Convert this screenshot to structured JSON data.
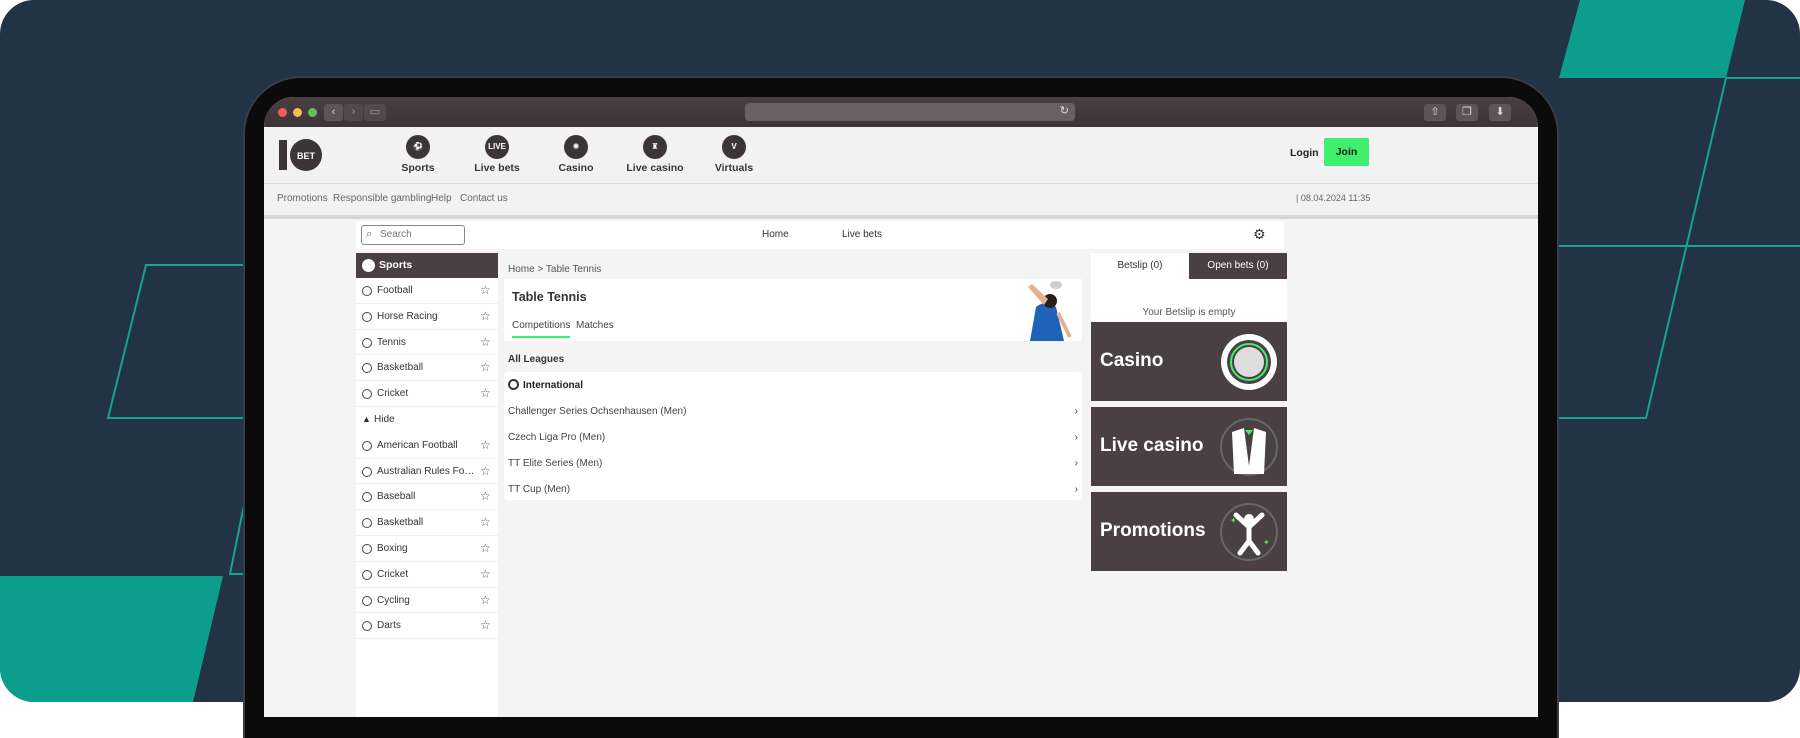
{
  "browser": {
    "back": "‹",
    "forward": "›",
    "reload": "↻"
  },
  "brand": {
    "logo_text": "BET",
    "accent": "#3ef06e",
    "dark": "#4a4044"
  },
  "topnav": {
    "items": [
      {
        "label": "Sports",
        "icon": "soccer-ball-icon"
      },
      {
        "label": "Live bets",
        "icon": "live-icon",
        "badge": "LIVE"
      },
      {
        "label": "Casino",
        "icon": "casino-chip-icon"
      },
      {
        "label": "Live casino",
        "icon": "tuxedo-icon"
      },
      {
        "label": "Virtuals",
        "icon": "virtual-screen-icon",
        "badge": "V"
      }
    ],
    "login": "Login",
    "join": "Join"
  },
  "subnav": {
    "links": [
      "Promotions",
      "Responsible gambling",
      "Help",
      "Contact us"
    ],
    "datetime": "| 08.04.2024 11:35"
  },
  "searchbar": {
    "placeholder": "Search",
    "links": [
      "Home",
      "Live bets"
    ]
  },
  "sidebar": {
    "title": "Sports",
    "top_items": [
      "Football",
      "Horse Racing",
      "Tennis",
      "Basketball",
      "Cricket"
    ],
    "hide_label": "Hide",
    "more_items": [
      "American Football",
      "Australian Rules Football",
      "Baseball",
      "Basketball",
      "Boxing",
      "Cricket",
      "Cycling",
      "Darts"
    ]
  },
  "main": {
    "breadcrumb": "Home > Table Tennis",
    "title": "Table Tennis",
    "tabs": [
      "Competitions",
      "Matches"
    ],
    "all_leagues": "All Leagues",
    "group": "International",
    "leagues": [
      "Challenger Series Ochsenhausen (Men)",
      "Czech Liga Pro (Men)",
      "TT Elite Series (Men)",
      "TT Cup (Men)"
    ]
  },
  "betslip": {
    "tab1": "Betslip (0)",
    "tab2": "Open bets (0)",
    "empty": "Your Betslip is empty"
  },
  "promos": [
    "Casino",
    "Live casino",
    "Promotions"
  ]
}
